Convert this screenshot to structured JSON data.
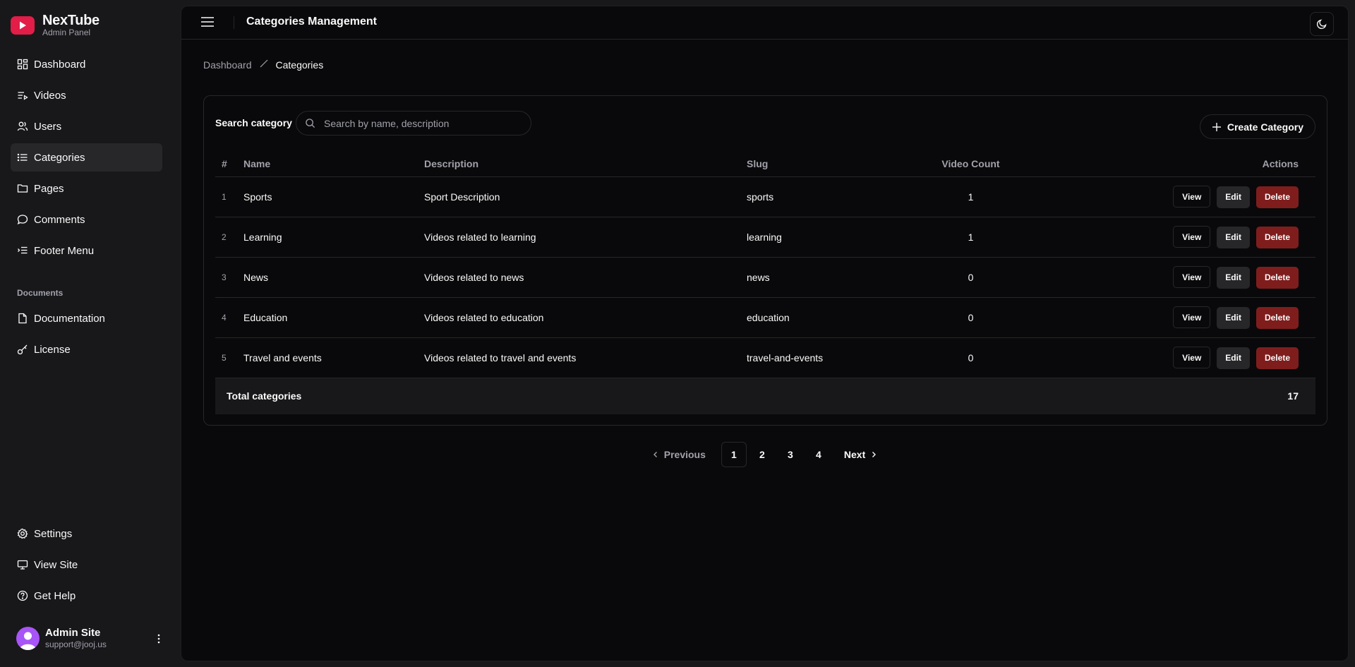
{
  "brand": {
    "name": "NexTube",
    "subtitle": "Admin Panel",
    "logo_color": "#e11d48"
  },
  "sidebar": {
    "main_items": [
      {
        "label": "Dashboard",
        "icon": "dashboard-icon"
      },
      {
        "label": "Videos",
        "icon": "video-list-icon"
      },
      {
        "label": "Users",
        "icon": "users-icon"
      },
      {
        "label": "Categories",
        "icon": "list-icon",
        "active": true
      },
      {
        "label": "Pages",
        "icon": "folder-icon"
      },
      {
        "label": "Comments",
        "icon": "comment-icon"
      },
      {
        "label": "Footer Menu",
        "icon": "indent-list-icon"
      }
    ],
    "documents_heading": "Documents",
    "document_items": [
      {
        "label": "Documentation",
        "icon": "file-icon"
      },
      {
        "label": "License",
        "icon": "key-icon"
      }
    ],
    "bottom_items": [
      {
        "label": "Settings",
        "icon": "gear-icon"
      },
      {
        "label": "View Site",
        "icon": "monitor-icon"
      },
      {
        "label": "Get Help",
        "icon": "help-icon"
      }
    ],
    "user": {
      "name": "Admin Site",
      "email": "support@jooj.us",
      "avatar_color": "#a855f7"
    }
  },
  "header": {
    "title": "Categories Management"
  },
  "breadcrumb": {
    "home": "Dashboard",
    "current": "Categories"
  },
  "search": {
    "label": "Search category",
    "placeholder": "Search by name, description",
    "value": ""
  },
  "create_button": "Create Category",
  "table": {
    "columns": {
      "index": "#",
      "name": "Name",
      "description": "Description",
      "slug": "Slug",
      "count": "Video Count",
      "actions": "Actions"
    },
    "rows": [
      {
        "index": "1",
        "name": "Sports",
        "description": "Sport Description",
        "slug": "sports",
        "count": "1"
      },
      {
        "index": "2",
        "name": "Learning",
        "description": "Videos related to learning",
        "slug": "learning",
        "count": "1"
      },
      {
        "index": "3",
        "name": "News",
        "description": "Videos related to news",
        "slug": "news",
        "count": "0"
      },
      {
        "index": "4",
        "name": "Education",
        "description": "Videos related to education",
        "slug": "education",
        "count": "0"
      },
      {
        "index": "5",
        "name": "Travel and events",
        "description": "Videos related to travel and events",
        "slug": "travel-and-events",
        "count": "0"
      }
    ],
    "actions": {
      "view": "View",
      "edit": "Edit",
      "delete": "Delete"
    },
    "footer": {
      "label": "Total categories",
      "value": "17"
    }
  },
  "pagination": {
    "previous": "Previous",
    "next": "Next",
    "pages": [
      "1",
      "2",
      "3",
      "4"
    ],
    "current": "1"
  },
  "colors": {
    "danger": "#7f1d1d",
    "accent_avatar": "#a855f7"
  }
}
